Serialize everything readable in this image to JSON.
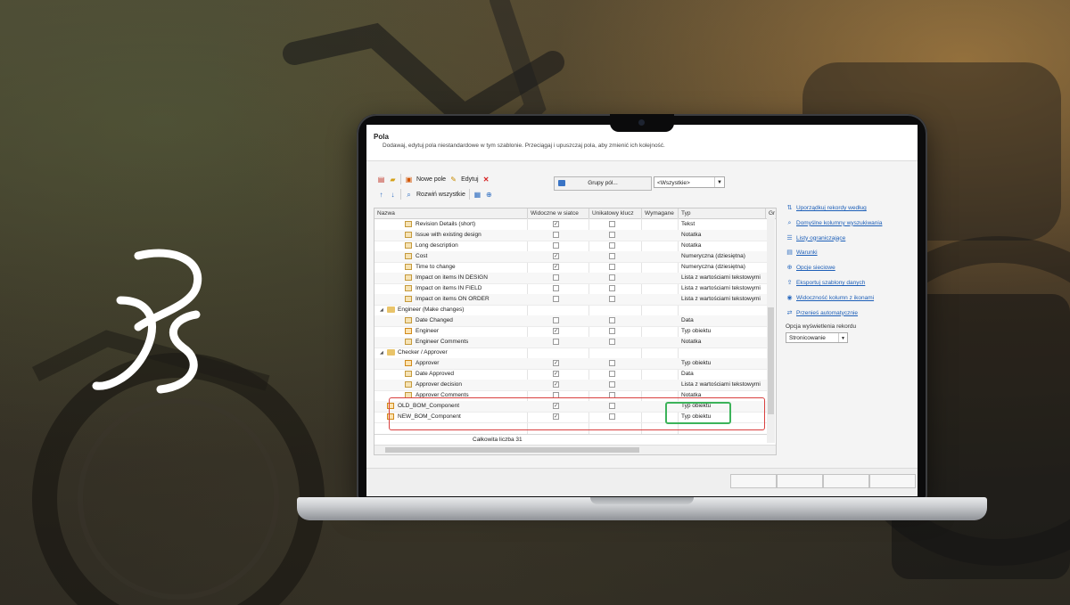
{
  "dialog": {
    "title": "Pola",
    "subtitle": "Dodawaj, edytuj pola niestandardowe w tym szablonie. Przeciągaj i upuszczaj pola, aby zmienić ich kolejność."
  },
  "toolbar": {
    "new_field": "Nowe pole",
    "edit": "Edytuj",
    "expand_all": "Rozwiń wszystkie",
    "field_groups": "Grupy pól...",
    "filter_value": "<Wszystkie>"
  },
  "grid": {
    "columns": [
      "Nazwa",
      "Widoczne w siatce",
      "Unikatowy klucz",
      "Wymagane",
      "Typ",
      "Gr"
    ],
    "rows": [
      {
        "kind": "field",
        "name": "Revision Details (short)",
        "visible": true,
        "unique": false,
        "type": "Tekst"
      },
      {
        "kind": "field",
        "name": "Issue with existing design",
        "visible": false,
        "unique": false,
        "type": "Notatka"
      },
      {
        "kind": "field",
        "name": "Long description",
        "visible": false,
        "unique": false,
        "type": "Notatka"
      },
      {
        "kind": "field",
        "name": "Cost",
        "visible": true,
        "unique": false,
        "type": "Numeryczna (dziesiętna)"
      },
      {
        "kind": "field",
        "name": "Time to change",
        "visible": true,
        "unique": false,
        "type": "Numeryczna (dziesiętna)"
      },
      {
        "kind": "field",
        "name": "Impact on items IN DESIGN",
        "visible": false,
        "unique": false,
        "type": "Lista z wartościami tekstowymi"
      },
      {
        "kind": "field",
        "name": "Impact on items IN FIELD",
        "visible": false,
        "unique": false,
        "type": "Lista z wartościami tekstowymi"
      },
      {
        "kind": "field",
        "name": "Impact on items ON ORDER",
        "visible": false,
        "unique": false,
        "type": "Lista z wartościami tekstowymi"
      },
      {
        "kind": "group",
        "name": "Engineer (Make changes)"
      },
      {
        "kind": "field",
        "name": "Date Changed",
        "visible": false,
        "unique": false,
        "type": "Data"
      },
      {
        "kind": "field",
        "name": "Engineer",
        "visible": true,
        "unique": false,
        "type": "Typ obiektu"
      },
      {
        "kind": "field",
        "name": "Engineer Comments",
        "visible": false,
        "unique": false,
        "type": "Notatka"
      },
      {
        "kind": "group",
        "name": "Checker / Approver"
      },
      {
        "kind": "field",
        "name": "Approver",
        "visible": true,
        "unique": false,
        "type": "Typ obiektu"
      },
      {
        "kind": "field",
        "name": "Date Approved",
        "visible": true,
        "unique": false,
        "type": "Data"
      },
      {
        "kind": "field",
        "name": "Approver decision",
        "visible": true,
        "unique": false,
        "type": "Lista z wartościami tekstowymi"
      },
      {
        "kind": "field",
        "name": "Approver Comments",
        "visible": false,
        "unique": false,
        "type": "Notatka"
      },
      {
        "kind": "top",
        "name": "OLD_BOM_Component",
        "visible": true,
        "unique": false,
        "type": "Typ obiektu"
      },
      {
        "kind": "top",
        "name": "NEW_BOM_Component",
        "visible": true,
        "unique": false,
        "type": "Typ obiektu"
      }
    ],
    "footer_total": "Całkowita liczba 31"
  },
  "side_panel": {
    "links": [
      {
        "icon": "sort-icon",
        "label": "Uporządkuj rekordy według"
      },
      {
        "icon": "search-icon",
        "label": "Domyślne kolumny wyszukiwania"
      },
      {
        "icon": "list-icon",
        "label": "Listy ograniczające"
      },
      {
        "icon": "conditions-icon",
        "label": "Warunki"
      },
      {
        "icon": "globe-icon",
        "label": "Opcje sieciowe"
      },
      {
        "icon": "export-icon",
        "label": "Eksportuj szablony danych"
      },
      {
        "icon": "eye-icon",
        "label": "Widoczność kolumn z ikonami"
      },
      {
        "icon": "transfer-icon",
        "label": "Przenieś automatycznie"
      }
    ],
    "display_label": "Opcja wyświetlenia rekordu",
    "display_value": "Stronicowanie"
  },
  "colors": {
    "highlight_red": "#d9403f",
    "highlight_green": "#3cb35a",
    "link_blue": "#1d5fb8"
  }
}
